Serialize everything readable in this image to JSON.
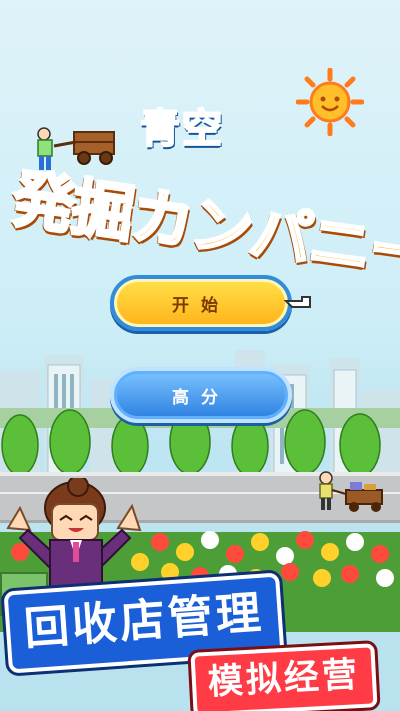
{
  "title": {
    "small": "青空",
    "big": "発掘カンパニー"
  },
  "buttons": {
    "start": "开始",
    "score": "高分"
  },
  "banner": {
    "line1": "回收店管理",
    "line2": "模拟经营"
  },
  "colors": {
    "sky": "#cdeef7",
    "start_btn": "#ffc52a",
    "score_btn": "#3b8eea",
    "banner_blue": "#1a5fd8",
    "banner_red": "#ff3b45"
  },
  "icons": [
    "sun-icon",
    "pointer-hand-icon",
    "cart-worker-icon",
    "girl-character"
  ]
}
